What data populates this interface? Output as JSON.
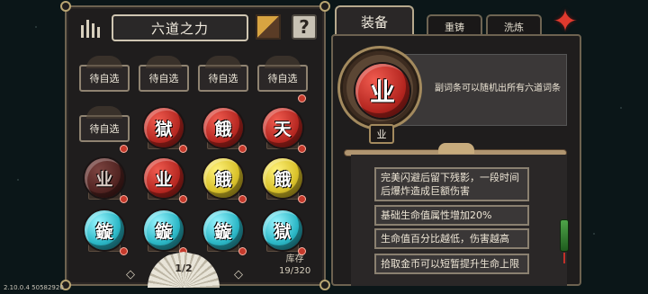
{
  "left_panel": {
    "title": "六道之力",
    "help_label": "?",
    "empty_label": "待自选",
    "slots": [
      {
        "kind": "empty"
      },
      {
        "kind": "empty"
      },
      {
        "kind": "empty"
      },
      {
        "kind": "empty"
      },
      {
        "kind": "empty"
      },
      {
        "kind": "orb",
        "glyph": "獄",
        "color": "red"
      },
      {
        "kind": "orb",
        "glyph": "餓",
        "color": "red"
      },
      {
        "kind": "orb",
        "glyph": "天",
        "color": "red"
      },
      {
        "kind": "orb",
        "glyph": "业",
        "color": "red-dim"
      },
      {
        "kind": "orb",
        "glyph": "业",
        "color": "red"
      },
      {
        "kind": "orb",
        "glyph": "餓",
        "color": "gold"
      },
      {
        "kind": "orb",
        "glyph": "餓",
        "color": "gold"
      },
      {
        "kind": "orb",
        "glyph": "鏇",
        "color": "cyan"
      },
      {
        "kind": "orb",
        "glyph": "鏇",
        "color": "cyan"
      },
      {
        "kind": "orb",
        "glyph": "鏇",
        "color": "cyan"
      },
      {
        "kind": "orb",
        "glyph": "獄",
        "color": "cyan"
      }
    ],
    "page": "1/2",
    "prev_arrow": "◇",
    "next_arrow": "◇",
    "stock_label": "库存",
    "stock_value": "19/320"
  },
  "right_panel": {
    "tabs": [
      "装备",
      "重铸",
      "洗炼"
    ],
    "item_glyph": "业",
    "item_label": "业",
    "item_description": "副词条可以随机出所有六道词条",
    "effects": [
      "完美闪避后留下残影，一段时间后爆炸造成巨额伤害",
      "基础生命值属性增加20%",
      "生命值百分比越低，伤害越高",
      "拾取金币可以短暂提升生命上限"
    ]
  },
  "version": "2.10.0.4 50582920",
  "colors": {
    "red": "#b3251f",
    "gold": "#d9c12a",
    "cyan": "#2bb7c6",
    "frame": "#6d6250"
  }
}
